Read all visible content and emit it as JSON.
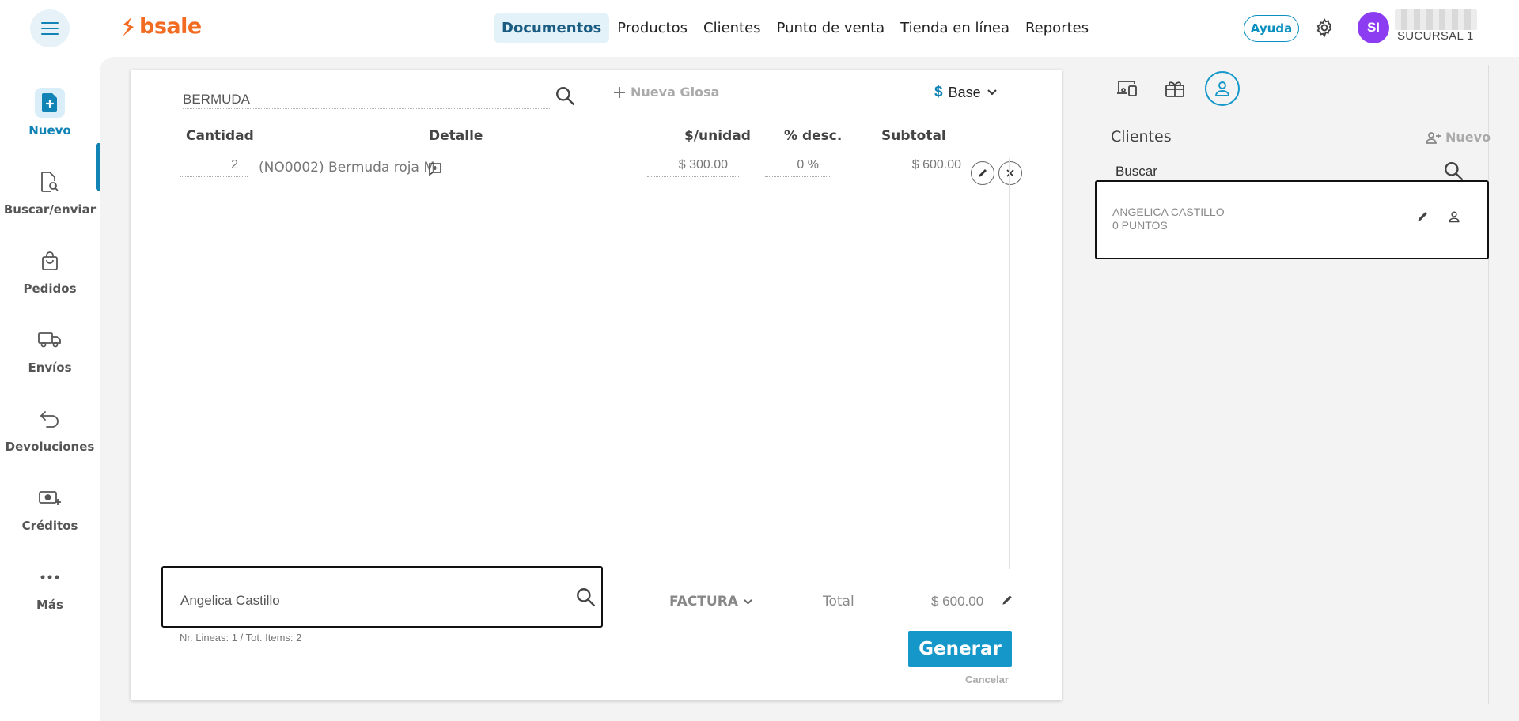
{
  "brand": {
    "logo_text": "bsale",
    "color": "#f26b22"
  },
  "topnav": [
    {
      "label": "Documentos",
      "active": true
    },
    {
      "label": "Productos",
      "active": false
    },
    {
      "label": "Clientes",
      "active": false
    },
    {
      "label": "Punto de venta",
      "active": false
    },
    {
      "label": "Tienda en línea",
      "active": false
    },
    {
      "label": "Reportes",
      "active": false
    }
  ],
  "header": {
    "help_label": "Ayuda",
    "avatar_initials": "SI",
    "branch": "SUCURSAL 1"
  },
  "sidebar": [
    {
      "label": "Nuevo",
      "icon": "new-document-icon",
      "active": true
    },
    {
      "label": "Buscar/enviar",
      "icon": "search-document-icon",
      "active": false
    },
    {
      "label": "Pedidos",
      "icon": "shopping-bag-icon",
      "active": false
    },
    {
      "label": "Envíos",
      "icon": "truck-icon",
      "active": false
    },
    {
      "label": "Devoluciones",
      "icon": "return-arrow-icon",
      "active": false
    },
    {
      "label": "Créditos",
      "icon": "credit-icon",
      "active": false
    },
    {
      "label": "Más",
      "icon": "more-dots-icon",
      "active": false
    }
  ],
  "document": {
    "product_search_value": "BERMUDA",
    "new_gloss_label": "Nueva Glosa",
    "price_list_symbol": "$",
    "price_list_label": "Base",
    "columns": {
      "qty": "Cantidad",
      "detail": "Detalle",
      "unit_price": "$/unidad",
      "discount": "% desc.",
      "subtotal": "Subtotal"
    },
    "lines": [
      {
        "qty": "2",
        "detail": "(NO0002) Bermuda roja M",
        "unit_price": "$ 300.00",
        "discount": "0 %",
        "subtotal": "$ 600.00"
      }
    ],
    "client_field_value": "Angelica Castillo",
    "doc_type": "FACTURA",
    "total_label": "Total",
    "total_value": "$ 600.00",
    "lines_info": "Nr. Lineas: 1 / Tot. Items: 2",
    "generate_label": "Generar",
    "cancel_label": "Cancelar"
  },
  "clients_panel": {
    "title": "Clientes",
    "new_label": "Nuevo",
    "search_value": "Buscar",
    "results": [
      {
        "name": "ANGELICA CASTILLO",
        "points": "0 PUNTOS"
      }
    ]
  },
  "colors": {
    "accent": "#1697c9",
    "avatar": "#8c3df2",
    "nav_active_bg": "#e3f1f8"
  }
}
